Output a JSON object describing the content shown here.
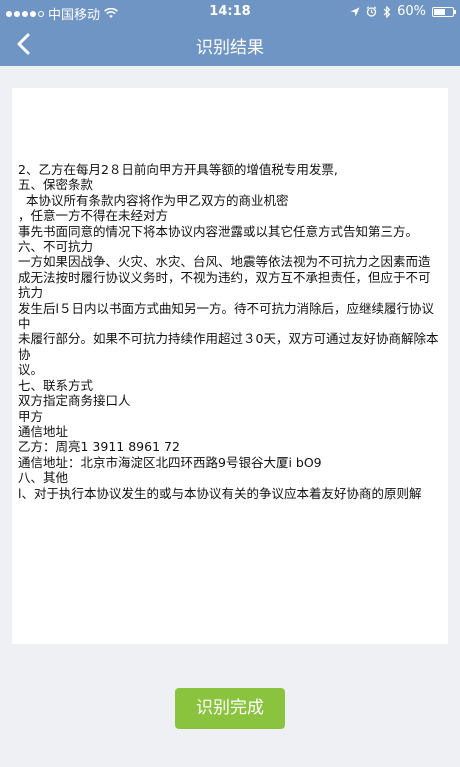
{
  "status_bar": {
    "carrier": "中国移动",
    "time": "14:18",
    "battery": "60%",
    "battery_level": 0.6,
    "icons": [
      "signal-dots",
      "wifi-icon",
      "location-icon",
      "alarm-icon",
      "bluetooth-icon",
      "battery-icon"
    ]
  },
  "nav": {
    "back_icon": "chevron-left-icon",
    "title": "识别结果"
  },
  "document": {
    "lines": [
      "2、乙方在每月2８日前向甲方开具等额的增值税专用发票,",
      "五、保密条款",
      "  本协议所有条款内容将作为甲乙双方的商业机密",
      "，任意一方不得在未经对方",
      "事先书面同意的情况下将本协议内容泄露或以其它任意方式告知第三方。",
      "六、不可抗力",
      "一方如果因战争、火灾、水灾、台风、地震等依法视为不可抗力之因素而造",
      "成无法按时履行协议义务时，不视为违约，双方互不承担责任，但应于不可抗力",
      "发生后l５日内以书面方式曲知另一方。待不可抗力消除后，应继续履行协议中",
      "未履行部分。如果不可抗力持续作用超过３0天，双方可通过友好协商解除本协",
      "议。",
      "七、联系方式",
      "双方指定商务接口人",
      "甲方",
      "通信地址",
      "乙方：周亮1 3911 8961 72",
      "通信地址：北京市海淀区北四环西路9号银谷大厦i bO9",
      "八、其他",
      "l、对于执行本协议发生的或与本协议有关的争议应本着友好协商的原则解"
    ]
  },
  "actions": {
    "finish_label": "识别完成"
  },
  "colors": {
    "header": "#6f95c5",
    "finish_button": "#8ac43f",
    "background": "#eef0f3"
  }
}
